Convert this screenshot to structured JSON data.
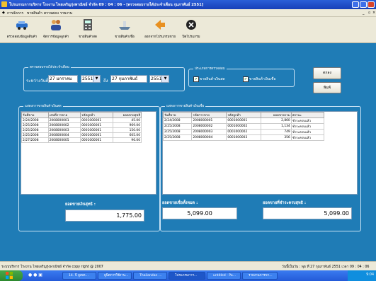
{
  "window": {
    "title": "โปรแกรมการบริหาร โรงงาน ไทยเจริญรุ่งพาณิชย์ จำกัด 09 : 04 : 06 - [ตรวจสอบรายได้ประจำเดือน  กุมภาพันธ์ 2551]"
  },
  "menu": [
    "การจัดการ",
    "ขายสินค้า",
    "ตรวจสอบ",
    "รายงาน"
  ],
  "toolbar": [
    {
      "label": "ตรวจสอบข้อมูลสินค้า",
      "icon": "car-icon"
    },
    {
      "label": "จัดการข้อมูลลูกค้า",
      "icon": "users-icon"
    },
    {
      "label": "ขายสินค้าสด",
      "icon": "calculator-icon"
    },
    {
      "label": "ขายสินค้าเชื่อ",
      "icon": "boat-icon"
    },
    {
      "label": "ออกจากโปรแกรมขาย",
      "icon": "exit-icon"
    },
    {
      "label": "ปิดโปรแกรม",
      "icon": "close-circle-icon"
    }
  ],
  "filter": {
    "group_label": "ตรวจสอบรายได้ประจำเดือน",
    "range_label": "ระหว่างวันที่",
    "from_day": "27",
    "from_month": "มกราคม",
    "from_year": "2551",
    "to_label": "ถึง",
    "to_day": "27",
    "to_month": "กุมภาพันธ์",
    "to_year": "2551"
  },
  "types": {
    "group_label": "ประเภทการตรวจสอบ",
    "cash_label": "ขายสินค้าเงินสด",
    "credit_label": "ขายสินค้าเงินเชื่อ"
  },
  "buttons": {
    "check": "ตกลง",
    "print": "พิมพ์"
  },
  "left_panel": {
    "label": "แสดงการขายสินค้าเงินสด",
    "columns": [
      "วันที่ขาย",
      "เลขที่การขาย",
      "รหัสลูกค้า",
      "ยอดขายสุทธิ"
    ],
    "rows": [
      [
        "2/24/2008",
        "2008000001",
        "0001000001",
        "45.00"
      ],
      [
        "2/25/2008",
        "2008000002",
        "0001000001",
        "969.00"
      ],
      [
        "2/25/2008",
        "2008000003",
        "0001000001",
        "150.00"
      ],
      [
        "2/25/2008",
        "2008000004",
        "0001000001",
        "605.00"
      ],
      [
        "2/27/2008",
        "2008000005",
        "0001000001",
        "96.00"
      ]
    ],
    "total_label": "ยอดขายเงินสุทธิ :",
    "total_value": "1,775.00"
  },
  "right_panel": {
    "label": "แสดงการขายสินค้าเงินเชื่อ",
    "columns": [
      "วันที่ขาย",
      "รหัสการขาย",
      "รหัสลูกค้า",
      "ยอดขายรวม",
      "สถานะ"
    ],
    "rows": [
      [
        "2/24/2008",
        "2008000001",
        "0001000001",
        "2,860",
        "ชำระครบแล้ว"
      ],
      [
        "2/25/2008",
        "2008000002",
        "0001000002",
        "1,134",
        "ชำระครบแล้ว"
      ],
      [
        "2/25/2008",
        "2008000003",
        "0001000002",
        "749",
        "ชำระครบแล้ว"
      ],
      [
        "2/25/2008",
        "2008000004",
        "0001000003",
        "356",
        "ชำระครบแล้ว"
      ]
    ],
    "total_all_label": "ยอดขายเชื่อทั้งหมด :",
    "total_all_value": "5,099.00",
    "total_paid_label": "ยอดขายที่ชำระครบสุทธิ :",
    "total_paid_value": "5,099.00"
  },
  "status": {
    "left": "ระบบบริหาร โรงงาน ไทยเจริญรุ่งพาณิชย์ จำกัด copy right @ 2007",
    "right": "วันนี้เป็นวัน :  พุธ  ที่  27 กุมภาพันธ์ 2551   เวลา  09 : 04 : 06"
  },
  "taskbar": {
    "tasks": [
      "14. ปี ยูเขต...",
      "ยูนิตการใช้งาน...",
      "Thailandan ...",
      "โปรแกรมการ...",
      "untitled - Pa...",
      "รายงานการขา..."
    ],
    "time": "9:04"
  },
  "colors": {
    "main_bg": "#1f7cb6",
    "titlebar": "#1f4fc8",
    "taskbar": "#245ad8"
  }
}
